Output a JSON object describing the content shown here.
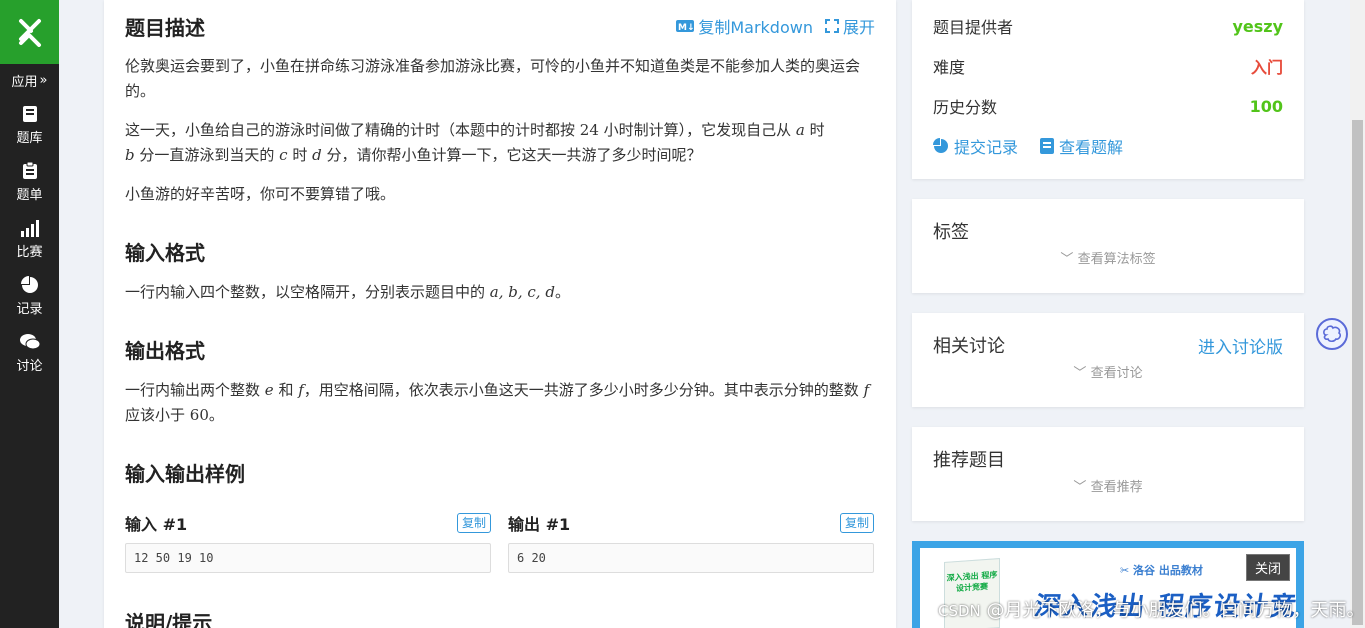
{
  "sidebar": {
    "app_label": "应用",
    "app_chevron": "»",
    "items": [
      {
        "label": "题库",
        "icon": "book-icon"
      },
      {
        "label": "题单",
        "icon": "clipboard-icon"
      },
      {
        "label": "比赛",
        "icon": "bar-signal-icon"
      },
      {
        "label": "记录",
        "icon": "pie-chart-icon"
      },
      {
        "label": "讨论",
        "icon": "chat-bubbles-icon"
      }
    ]
  },
  "problem": {
    "desc_title": "题目描述",
    "copy_markdown": "复制Markdown",
    "expand": "展开",
    "p1": "伦敦奥运会要到了，小鱼在拼命练习游泳准备参加游泳比赛，可怜的小鱼并不知道鱼类是不能参加人类的奥运会的。",
    "p2": {
      "a": "这一天，小鱼给自己的游泳时间做了精确的计时（本题中的计时都按 ",
      "n24": "24",
      "b": " 小时制计算），它发现自己从 ",
      "va": "a",
      "c": " 时",
      "vb": "b",
      "d": " 分一直游泳到当天的 ",
      "vc": "c",
      "e": " 时 ",
      "vd": "d",
      "f": " 分，请你帮小鱼计算一下，它这天一共游了多少时间呢？"
    },
    "p3": "小鱼游的好辛苦呀，你可不要算错了哦。",
    "input_title": "输入格式",
    "input_text": {
      "a": "一行内输入四个整数，以空格隔开，分别表示题目中的 ",
      "math": "a, b, c, d",
      "b": "。"
    },
    "output_title": "输出格式",
    "output_text": {
      "a": "一行内输出两个整数 ",
      "ve": "e",
      "b": " 和 ",
      "vf": "f",
      "c": "，用空格间隔，依次表示小鱼这天一共游了多少小时多少分钟。其中表示分钟的整数 ",
      "vf2": "f",
      "d": " 应该小于 ",
      "n60": "60",
      "e": "。"
    },
    "samples_title": "输入输出样例",
    "sample_in_title": "输入 #1",
    "sample_out_title": "输出 #1",
    "copy": "复制",
    "sample_in": "12 50 19 10",
    "sample_out": "6 20",
    "hint_title": "说明/提示"
  },
  "info": {
    "provider_label": "题目提供者",
    "provider_value": "yeszy",
    "difficulty_label": "难度",
    "difficulty_value": "入门",
    "score_label": "历史分数",
    "score_value": "100",
    "submissions": "提交记录",
    "solutions": "查看题解",
    "colors": {
      "green": "#52c41a",
      "red": "#e74c3c",
      "link": "#3498db"
    }
  },
  "tags": {
    "title": "标签",
    "more": "查看算法标签"
  },
  "discuss": {
    "title": "相关讨论",
    "enter": "进入讨论版",
    "more": "查看讨论"
  },
  "recommend": {
    "title": "推荐题目",
    "more": "查看推荐"
  },
  "ad": {
    "sub": "✂ 洛谷 出品教材",
    "big": "深入浅出 程序设计竞赛",
    "book": "深入浅出 程序设计竞赛",
    "close": "关闭"
  },
  "watermark": {
    "csdn": "CSDN",
    "text": " @月光下欧洛，与小朋友们。白间万物，天雨。"
  }
}
